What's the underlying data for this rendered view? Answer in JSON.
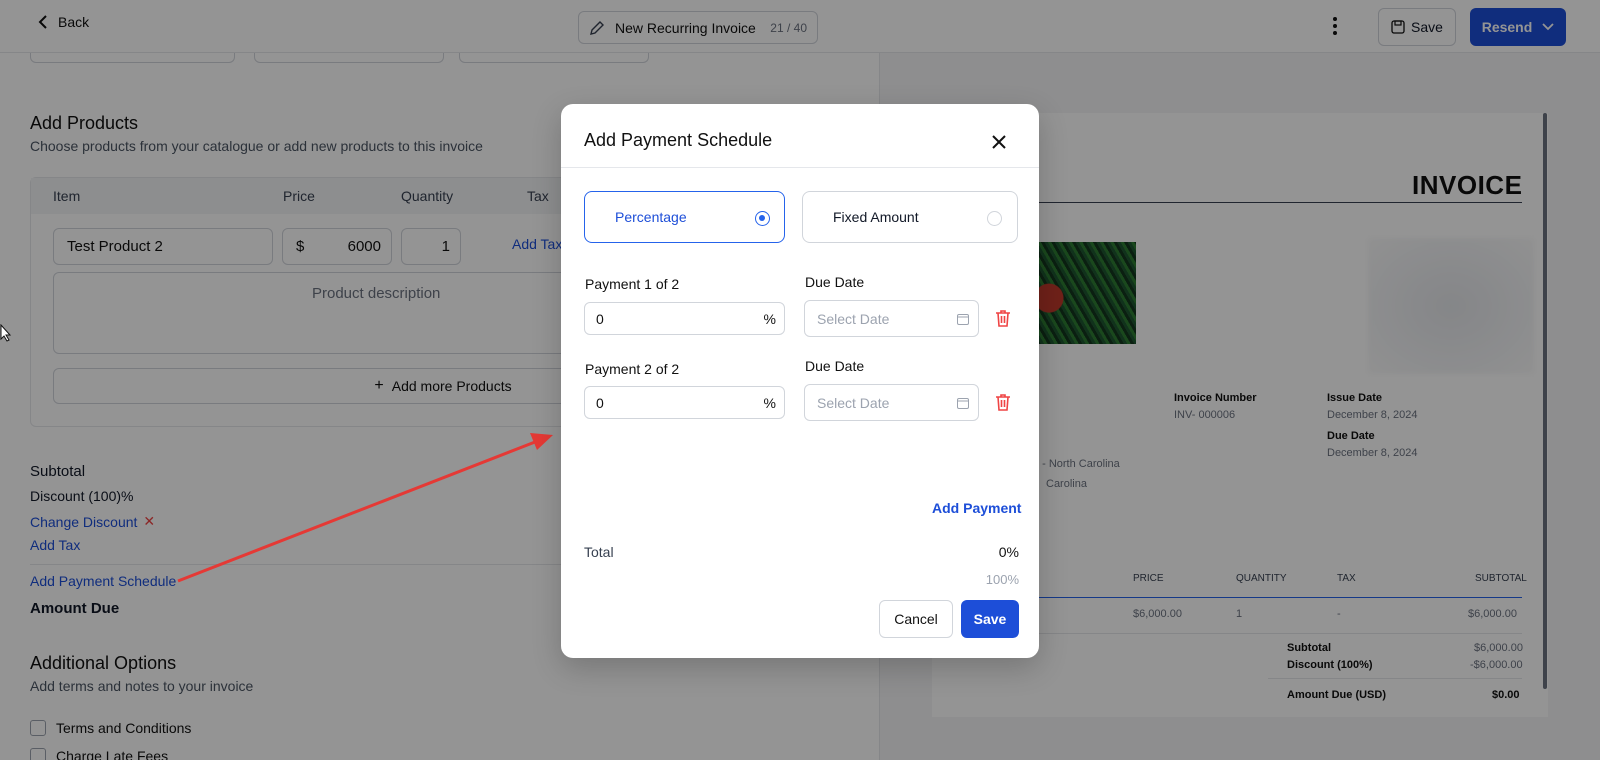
{
  "topbar": {
    "back_label": "Back",
    "title": "New Recurring Invoice",
    "title_count": "21 / 40",
    "save_label": "Save",
    "resend_label": "Resend"
  },
  "products": {
    "heading": "Add Products",
    "subheading": "Choose products from your catalogue or add new products to this invoice",
    "columns": [
      "Item",
      "Price",
      "Quantity",
      "Tax"
    ],
    "item_name": "Test Product 2",
    "currency_symbol": "$",
    "price": "6000",
    "quantity": "1",
    "add_tax_label": "Add Tax",
    "description_placeholder": "Product description",
    "add_more_label": "Add more Products"
  },
  "summary": {
    "subtotal_label": "Subtotal",
    "discount_label": "Discount (100)%",
    "change_discount_label": "Change Discount",
    "add_tax_label": "Add Tax",
    "add_payment_schedule_label": "Add Payment Schedule",
    "amount_due_label": "Amount Due"
  },
  "additional": {
    "heading": "Additional Options",
    "subheading": "Add terms and notes to your invoice",
    "terms_label": "Terms and Conditions",
    "late_fees_label": "Charge Late Fees"
  },
  "preview": {
    "title": "INVOICE",
    "invoice_number_label": "Invoice Number",
    "invoice_number": "INV- 000006",
    "issue_date_label": "Issue Date",
    "issue_date": "December 8, 2024",
    "due_date_label": "Due Date",
    "due_date": "December 8, 2024",
    "address_line_1": "t - North Carolina",
    "address_line_2": "Carolina",
    "table_headers": [
      "PRICE",
      "QUANTITY",
      "TAX",
      "SUBTOTAL"
    ],
    "row": {
      "price": "$6,000.00",
      "quantity": "1",
      "tax": "-",
      "subtotal": "$6,000.00"
    },
    "subtotal_label": "Subtotal",
    "subtotal_value": "$6,000.00",
    "discount_label": "Discount (100%)",
    "discount_value": "-$6,000.00",
    "amount_due_label": "Amount Due (USD)",
    "amount_due_value": "$0.00"
  },
  "modal": {
    "title": "Add Payment Schedule",
    "option_percentage": "Percentage",
    "option_fixed": "Fixed Amount",
    "selected_option": "Percentage",
    "payments": [
      {
        "label": "Payment 1 of 2",
        "value": "0",
        "unit": "%",
        "due_label": "Due Date",
        "date_placeholder": "Select Date"
      },
      {
        "label": "Payment 2 of 2",
        "value": "0",
        "unit": "%",
        "due_label": "Due Date",
        "date_placeholder": "Select Date"
      }
    ],
    "add_payment_label": "Add Payment",
    "total_label": "Total",
    "total_value": "0%",
    "total_max": "100%",
    "cancel_label": "Cancel",
    "save_label": "Save"
  },
  "colors": {
    "accent": "#1d4ed8",
    "danger": "#ef4444",
    "annotation_arrow": "#e53935"
  }
}
